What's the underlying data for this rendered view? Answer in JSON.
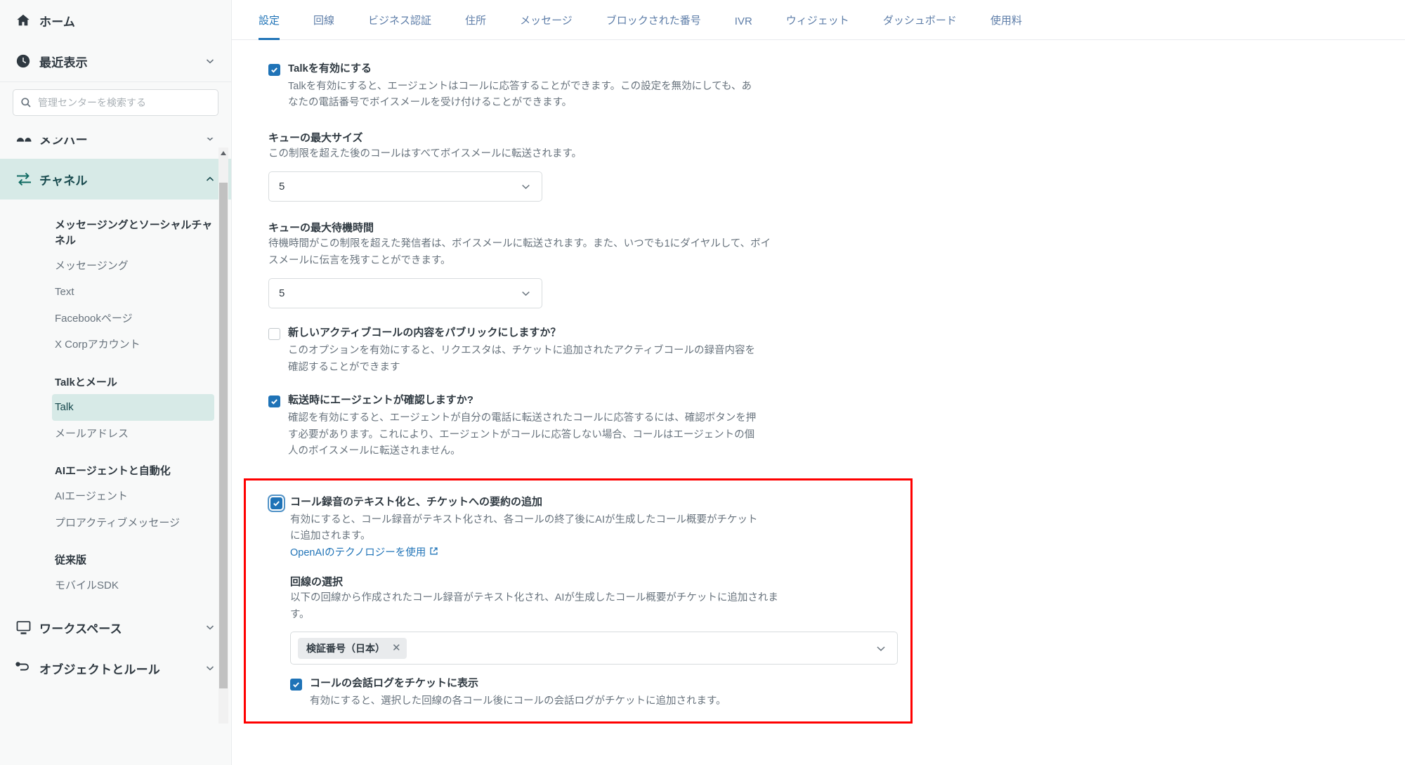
{
  "sidebar": {
    "home": {
      "label": "ホーム",
      "icon": "home-icon"
    },
    "recent": {
      "label": "最近表示",
      "icon": "clock-icon"
    },
    "search": {
      "placeholder": "管理センターを検索する",
      "value": "",
      "icon": "search-icon"
    },
    "members": {
      "label": "メンバー",
      "icon": "people-icon"
    },
    "channels": {
      "label": "チャネル",
      "icon": "channels-icon"
    },
    "groups": [
      {
        "title": "メッセージングとソーシャルチャネル",
        "items": [
          "メッセージング",
          "Text",
          "Facebookページ",
          "X Corpアカウント"
        ]
      },
      {
        "title": "Talkとメール",
        "items": [
          "Talk",
          "メールアドレス"
        ],
        "selected": "Talk"
      },
      {
        "title": "AIエージェントと自動化",
        "items": [
          "AIエージェント",
          "プロアクティブメッセージ"
        ]
      },
      {
        "title": "従来版",
        "items": [
          "モバイルSDK"
        ]
      }
    ],
    "workspace": {
      "label": "ワークスペース",
      "icon": "monitor-icon"
    },
    "objects": {
      "label": "オブジェクトとルール",
      "icon": "objects-icon"
    }
  },
  "tabs": [
    {
      "label": "設定",
      "active": true
    },
    {
      "label": "回線",
      "active": false
    },
    {
      "label": "ビジネス認証",
      "active": false
    },
    {
      "label": "住所",
      "active": false
    },
    {
      "label": "メッセージ",
      "active": false
    },
    {
      "label": "ブロックされた番号",
      "active": false
    },
    {
      "label": "IVR",
      "active": false
    },
    {
      "label": "ウィジェット",
      "active": false
    },
    {
      "label": "ダッシュボード",
      "active": false
    },
    {
      "label": "使用料",
      "active": false
    }
  ],
  "settings": {
    "enable_talk": {
      "label": "Talkを有効にする",
      "description": "Talkを有効にすると、エージェントはコールに応答することができます。この設定を無効にしても、あなたの電話番号でボイスメールを受け付けることができます。",
      "checked": true
    },
    "max_queue_size": {
      "label": "キューの最大サイズ",
      "description": "この制限を超えた後のコールはすべてボイスメールに転送されます。",
      "value": "5"
    },
    "max_queue_wait": {
      "label": "キューの最大待機時間",
      "description": "待機時間がこの制限を超えた発信者は、ボイスメールに転送されます。また、いつでも1にダイヤルして、ボイスメールに伝言を残すことができます。",
      "value": "5"
    },
    "public_active_call": {
      "label": "新しいアクティブコールの内容をパブリックにしますか？",
      "description": "このオプションを有効にすると、リクエスタは、チケットに追加されたアクティブコールの録音内容を確認することができます",
      "checked": false
    },
    "transfer_confirm": {
      "label": "転送時にエージェントが確認しますか?",
      "description": "確認を有効にすると、エージェントが自分の電話に転送されたコールに応答するには、確認ボタンを押す必要があります。これにより、エージェントがコールに応答しない場合、コールはエージェントの個人のボイスメールに転送されません。",
      "checked": true
    },
    "transcription": {
      "label": "コール録音のテキスト化と、チケットへの要約の追加",
      "description": "有効にすると、コール録音がテキスト化され、各コールの終了後にAIが生成したコール概要がチケットに追加されます。",
      "link_text": "OpenAIのテクノロジーを使用",
      "link_icon": "external-link-icon",
      "checked": true,
      "line_selection": {
        "label": "回線の選択",
        "description": "以下の回線から作成されたコール録音がテキスト化され、AIが生成したコール概要がチケットに追加されます。",
        "selected_tags": [
          "検証番号（日本）"
        ],
        "remove_icon": "close-icon"
      },
      "show_transcript": {
        "label": "コールの会話ログをチケットに表示",
        "description": "有効にすると、選択した回線の各コール後にコールの会話ログがチケットに追加されます。",
        "checked": true
      }
    }
  },
  "colors": {
    "accent": "#1f73b7",
    "highlight_box": "#ff0000",
    "sidebar_active": "#d7eae7",
    "sidebar_active_text": "#17494d"
  }
}
